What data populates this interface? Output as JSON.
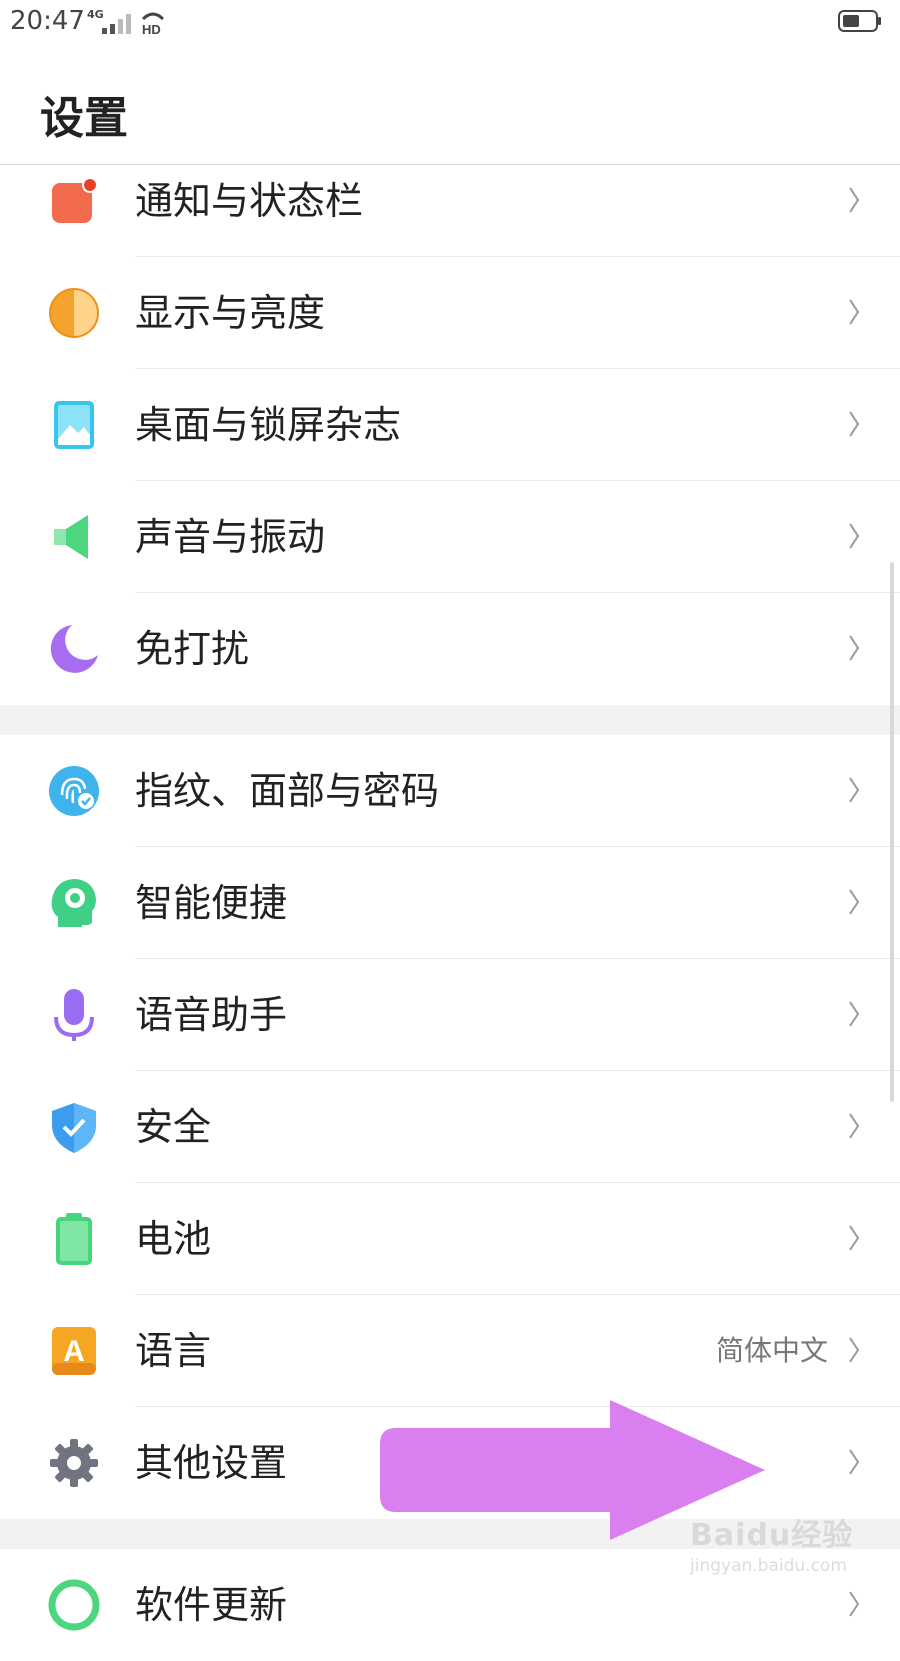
{
  "status_bar": {
    "time": "20:47",
    "network": "4G",
    "hd_label": "HD"
  },
  "header": {
    "title": "设置"
  },
  "groups": [
    {
      "items": [
        {
          "label": "通知与状态栏",
          "icon": "notification-icon"
        },
        {
          "label": "显示与亮度",
          "icon": "brightness-icon"
        },
        {
          "label": "桌面与锁屏杂志",
          "icon": "wallpaper-icon"
        },
        {
          "label": "声音与振动",
          "icon": "sound-icon"
        },
        {
          "label": "免打扰",
          "icon": "do-not-disturb-icon"
        }
      ]
    },
    {
      "items": [
        {
          "label": "指纹、面部与密码",
          "icon": "fingerprint-icon"
        },
        {
          "label": "智能便捷",
          "icon": "smart-assist-icon"
        },
        {
          "label": "语音助手",
          "icon": "microphone-icon"
        },
        {
          "label": "安全",
          "icon": "shield-icon"
        },
        {
          "label": "电池",
          "icon": "battery-icon"
        },
        {
          "label": "语言",
          "icon": "language-icon",
          "value": "简体中文"
        },
        {
          "label": "其他设置",
          "icon": "gear-icon"
        }
      ]
    },
    {
      "items": [
        {
          "label": "软件更新",
          "icon": "software-update-icon"
        }
      ]
    }
  ],
  "watermark": {
    "brand": "Baidu经验",
    "url": "jingyan.baidu.com"
  },
  "colors": {
    "arrow": "#d97ff0",
    "notification": "#f06a4b",
    "brightness": "#f4a42c",
    "wallpaper": "#35c6ef",
    "sound": "#4ed67f",
    "dnd": "#a86cf0",
    "fingerprint": "#3fb4ec",
    "smart": "#3fcf86",
    "mic": "#9a6cf2",
    "shield": "#3c9cf0",
    "battery": "#45d67c",
    "language": "#f5a623",
    "gear": "#707480"
  }
}
